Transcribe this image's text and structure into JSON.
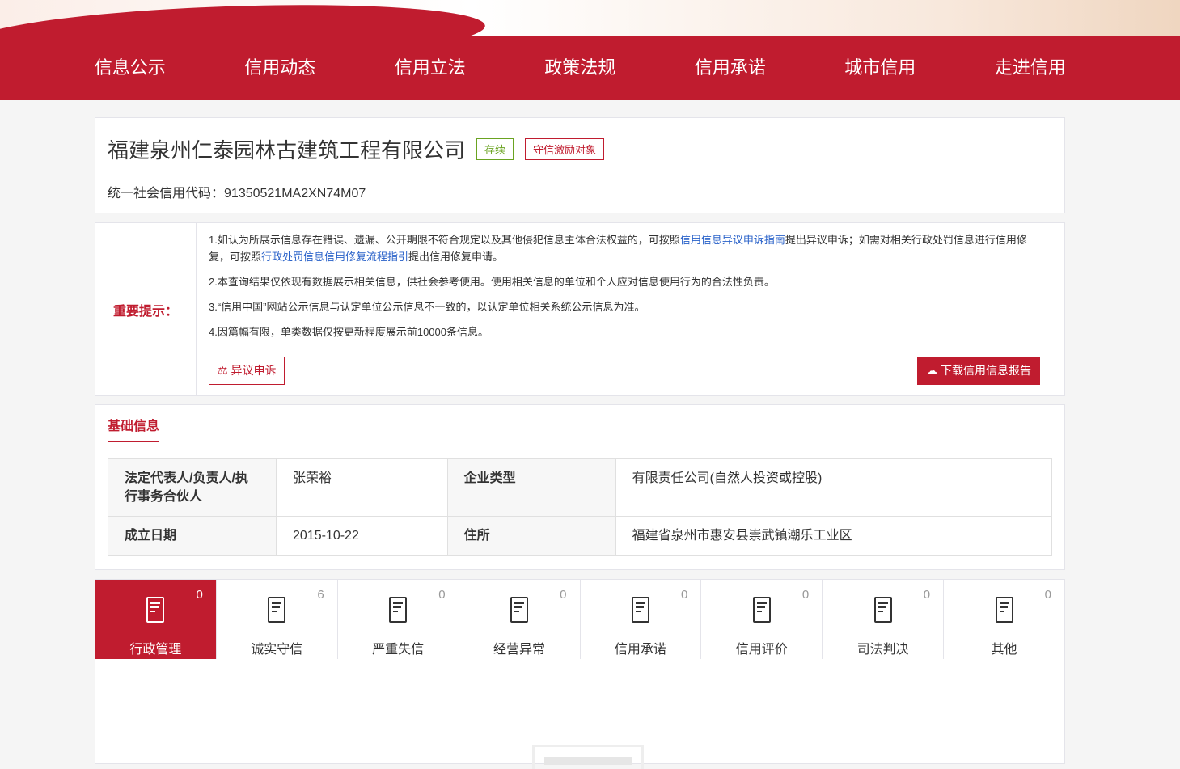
{
  "nav": [
    "信息公示",
    "信用动态",
    "信用立法",
    "政策法规",
    "信用承诺",
    "城市信用",
    "走进信用"
  ],
  "company": {
    "name": "福建泉州仁泰园林古建筑工程有限公司",
    "status": "存续",
    "badge": "守信激励对象",
    "code_label": "统一社会信用代码：",
    "code": "91350521MA2XN74M07"
  },
  "notice": {
    "label": "重要提示：",
    "p1a": "1.如认为所展示信息存在错误、遗漏、公开期限不符合规定以及其他侵犯信息主体合法权益的，可按照",
    "p1link1": "信用信息异议申诉指南",
    "p1b": "提出异议申诉；如需对相关行政处罚信息进行信用修复，可按照",
    "p1link2": "行政处罚信息信用修复流程指引",
    "p1c": "提出信用修复申请。",
    "p2": "2.本查询结果仅依现有数据展示相关信息，供社会参考使用。使用相关信息的单位和个人应对信息使用行为的合法性负责。",
    "p3": "3.“信用中国”网站公示信息与认定单位公示信息不一致的，以认定单位相关系统公示信息为准。",
    "p4": "4.因篇幅有限，单类数据仅按更新程度展示前10000条信息。",
    "objection_button": "异议申诉",
    "download_button": "下载信用信息报告"
  },
  "basic": {
    "title": "基础信息",
    "rows": [
      {
        "k1": "法定代表人/负责人/执行事务合伙人",
        "v1": "张荣裕",
        "k2": "企业类型",
        "v2": "有限责任公司(自然人投资或控股)"
      },
      {
        "k1": "成立日期",
        "v1": "2015-10-22",
        "k2": "住所",
        "v2": "福建省泉州市惠安县崇武镇潮乐工业区"
      }
    ]
  },
  "tabs": [
    {
      "label": "行政管理",
      "count": "0"
    },
    {
      "label": "诚实守信",
      "count": "6"
    },
    {
      "label": "严重失信",
      "count": "0"
    },
    {
      "label": "经营异常",
      "count": "0"
    },
    {
      "label": "信用承诺",
      "count": "0"
    },
    {
      "label": "信用评价",
      "count": "0"
    },
    {
      "label": "司法判决",
      "count": "0"
    },
    {
      "label": "其他",
      "count": "0"
    }
  ],
  "colors": {
    "brand": "#c01c2f",
    "link": "#2a62c9",
    "status": "#6aa321"
  }
}
